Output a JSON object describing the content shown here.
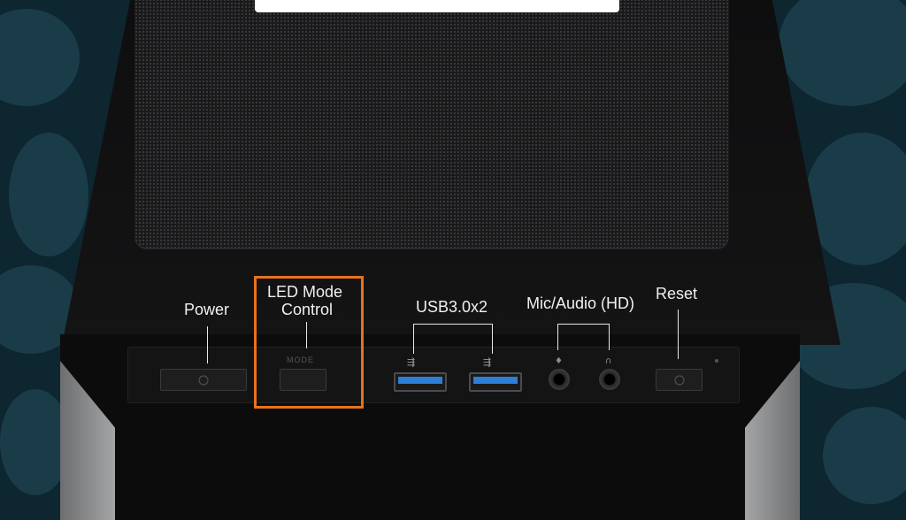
{
  "labels": {
    "power": "Power",
    "led_mode_line1": "LED Mode",
    "led_mode_line2": "Control",
    "usb": "USB3.0x2",
    "mic_audio": "Mic/Audio (HD)",
    "reset": "Reset"
  },
  "button_engraving": "MODE",
  "icons": {
    "usb": "usb-icon",
    "mic": "mic-icon",
    "headphone": "headphone-icon",
    "power": "power-icon",
    "reset": "reset-icon"
  },
  "colors": {
    "highlight": "#e8711e",
    "usb_port": "#2e7ed6",
    "background": "#0d2630"
  }
}
